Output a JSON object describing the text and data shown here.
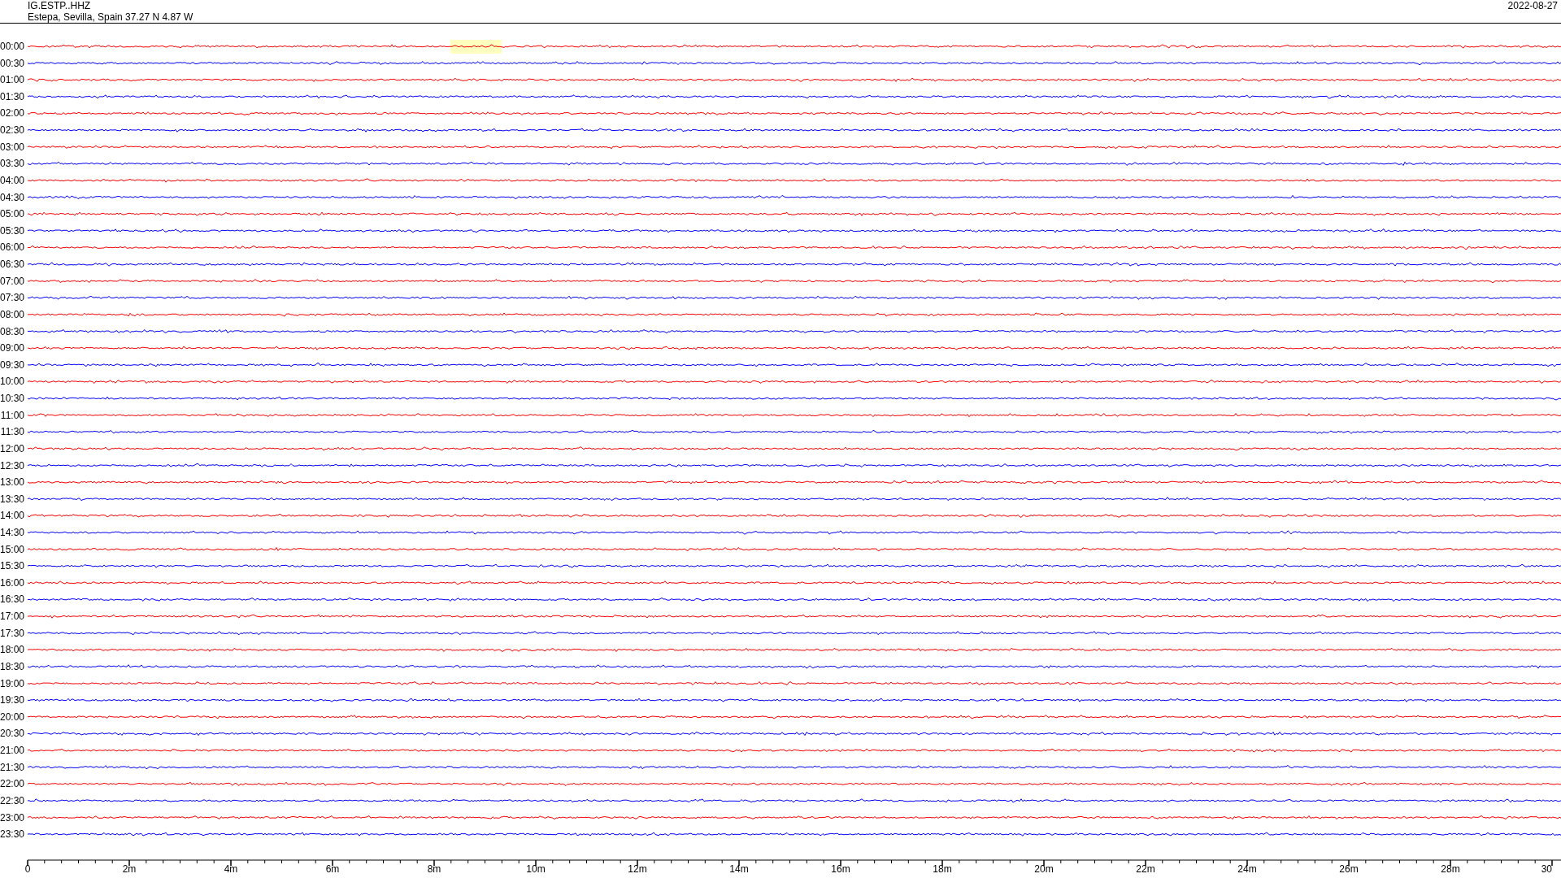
{
  "header": {
    "station": "IG.ESTP..HHZ",
    "location": "Estepa, Sevilla, Spain  37.27 N 4.87 W",
    "date": "2022-08-27"
  },
  "rows": [
    {
      "time": "00:00",
      "color": "#ff0000",
      "highlighted": true
    },
    {
      "time": "00:30",
      "color": "#0000ff",
      "highlighted": false
    },
    {
      "time": "01:00",
      "color": "#ff0000",
      "highlighted": false
    },
    {
      "time": "01:30",
      "color": "#0000ff",
      "highlighted": false
    },
    {
      "time": "02:00",
      "color": "#ff0000",
      "highlighted": false
    },
    {
      "time": "02:30",
      "color": "#0000ff",
      "highlighted": false
    },
    {
      "time": "03:00",
      "color": "#ff0000",
      "highlighted": false
    },
    {
      "time": "03:30",
      "color": "#0000ff",
      "highlighted": false
    },
    {
      "time": "04:00",
      "color": "#ff0000",
      "highlighted": false
    },
    {
      "time": "04:30",
      "color": "#0000ff",
      "highlighted": false
    },
    {
      "time": "05:00",
      "color": "#ff0000",
      "highlighted": false
    },
    {
      "time": "05:30",
      "color": "#0000ff",
      "highlighted": false
    },
    {
      "time": "06:00",
      "color": "#ff0000",
      "highlighted": false
    },
    {
      "time": "06:30",
      "color": "#0000ff",
      "highlighted": false
    },
    {
      "time": "07:00",
      "color": "#ff0000",
      "highlighted": false
    },
    {
      "time": "07:30",
      "color": "#0000ff",
      "highlighted": false
    },
    {
      "time": "08:00",
      "color": "#ff0000",
      "highlighted": false
    },
    {
      "time": "08:30",
      "color": "#0000ff",
      "highlighted": false
    },
    {
      "time": "09:00",
      "color": "#ff0000",
      "highlighted": false
    },
    {
      "time": "09:30",
      "color": "#0000ff",
      "highlighted": false
    },
    {
      "time": "10:00",
      "color": "#ff0000",
      "highlighted": false
    },
    {
      "time": "10:30",
      "color": "#0000ff",
      "highlighted": false
    },
    {
      "time": "11:00",
      "color": "#ff0000",
      "highlighted": false
    },
    {
      "time": "11:30",
      "color": "#0000ff",
      "highlighted": false
    },
    {
      "time": "12:00",
      "color": "#ff0000",
      "highlighted": false
    },
    {
      "time": "12:30",
      "color": "#0000ff",
      "highlighted": false
    },
    {
      "time": "13:00",
      "color": "#ff0000",
      "highlighted": false
    },
    {
      "time": "13:30",
      "color": "#0000ff",
      "highlighted": false
    },
    {
      "time": "14:00",
      "color": "#ff0000",
      "highlighted": false
    },
    {
      "time": "14:30",
      "color": "#0000ff",
      "highlighted": false
    },
    {
      "time": "15:00",
      "color": "#ff0000",
      "highlighted": false
    },
    {
      "time": "15:30",
      "color": "#0000ff",
      "highlighted": false
    },
    {
      "time": "16:00",
      "color": "#ff0000",
      "highlighted": false
    },
    {
      "time": "16:30",
      "color": "#0000ff",
      "highlighted": false
    },
    {
      "time": "17:00",
      "color": "#ff0000",
      "highlighted": false
    },
    {
      "time": "17:30",
      "color": "#0000ff",
      "highlighted": false
    },
    {
      "time": "18:00",
      "color": "#ff0000",
      "highlighted": false
    },
    {
      "time": "18:30",
      "color": "#0000ff",
      "highlighted": false
    },
    {
      "time": "19:00",
      "color": "#ff0000",
      "highlighted": false
    },
    {
      "time": "19:30",
      "color": "#0000ff",
      "highlighted": false
    },
    {
      "time": "20:00",
      "color": "#ff0000",
      "highlighted": false
    },
    {
      "time": "20:30",
      "color": "#0000ff",
      "highlighted": false
    },
    {
      "time": "21:00",
      "color": "#ff0000",
      "highlighted": false
    },
    {
      "time": "21:30",
      "color": "#0000ff",
      "highlighted": false
    },
    {
      "time": "22:00",
      "color": "#ff0000",
      "highlighted": false
    },
    {
      "time": "22:30",
      "color": "#0000ff",
      "highlighted": false
    },
    {
      "time": "23:00",
      "color": "#ff0000",
      "highlighted": false
    },
    {
      "time": "23:30",
      "color": "#0000ff",
      "highlighted": false
    }
  ],
  "x_axis": {
    "labels": [
      "0",
      "2m",
      "4m",
      "6m",
      "8m",
      "10m",
      "12m",
      "14m",
      "16m",
      "18m",
      "20m",
      "22m",
      "24m",
      "26m",
      "28m",
      "30"
    ]
  }
}
